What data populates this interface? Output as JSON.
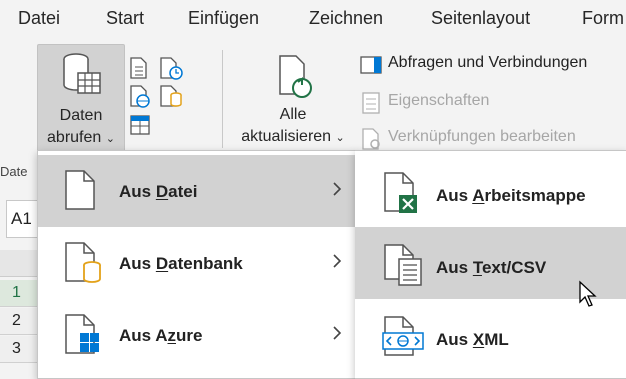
{
  "tabs": [
    "Datei",
    "Start",
    "Einfügen",
    "Zeichnen",
    "Seitenlayout",
    "Form"
  ],
  "ribbon": {
    "get_data": {
      "line1": "Daten",
      "line2": "abrufen"
    },
    "refresh_all": {
      "line1": "Alle",
      "line2": "aktualisieren"
    },
    "queries_connections": "Abfragen und Verbindungen",
    "properties": "Eigenschaften",
    "edit_links": "Verknüpfungen bearbeiten",
    "group_name": "Date"
  },
  "sheet": {
    "name_box": "A1",
    "rows": [
      "1",
      "2",
      "3"
    ]
  },
  "menu": {
    "items": [
      {
        "pre": "Aus ",
        "key": "D",
        "post": "atei"
      },
      {
        "pre": "Aus ",
        "key": "D",
        "post": "atenbank"
      },
      {
        "pre": "Aus A",
        "key": "z",
        "post": "ure"
      }
    ]
  },
  "submenu": {
    "items": [
      {
        "pre": "Aus ",
        "key": "A",
        "post": "rbeitsmappe"
      },
      {
        "pre": "Aus ",
        "key": "T",
        "post": "ext/CSV"
      },
      {
        "pre": "Aus ",
        "key": "X",
        "post": "ML"
      }
    ]
  },
  "colors": {
    "excel_green": "#217346",
    "azure_blue": "#0078d4",
    "db_orange": "#e3a21a",
    "hover": "#d2d2d2"
  },
  "icons": {
    "get_data": "database-table-icon",
    "from_file": "file-icon",
    "from_database": "database-file-icon",
    "from_azure": "azure-windows-icon",
    "from_workbook": "excel-workbook-icon",
    "from_text_csv": "text-file-icon",
    "from_xml": "xml-file-icon",
    "refresh": "refresh-icon"
  }
}
